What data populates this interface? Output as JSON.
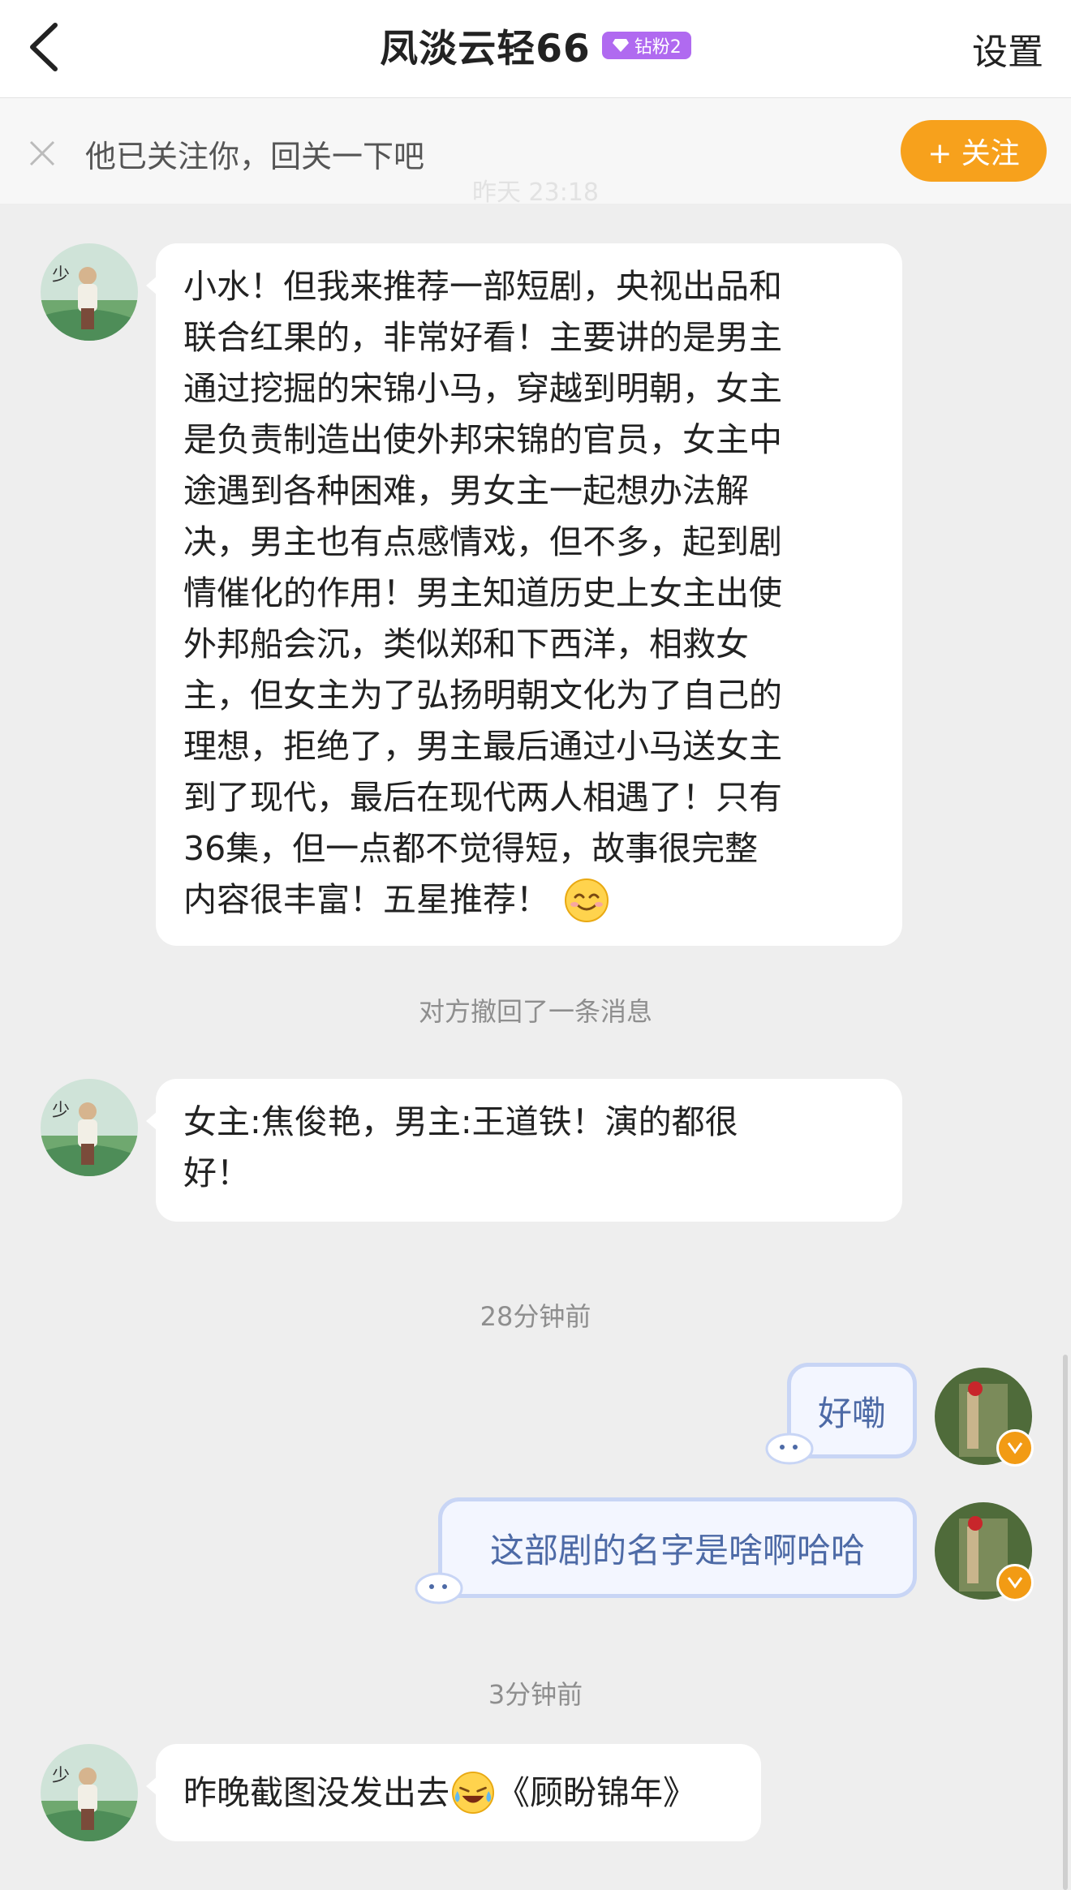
{
  "header": {
    "title": "凤淡云轻66",
    "fan_badge": "钻粉2",
    "settings_label": "设置"
  },
  "follow_bar": {
    "text": "他已关注你，回关一下吧",
    "button_label": "+ 关注",
    "ghost_timestamp": "昨天 23:18"
  },
  "messages": [
    {
      "side": "incoming",
      "text": "小水！但我来推荐一部短剧，央视出品和联合红果的，非常好看！主要讲的是男主通过挖掘的宋锦小马，穿越到明朝，女主是负责制造出使外邦宋锦的官员，女主中途遇到各种困难，男女主一起想办法解决，男主也有点感情戏，但不多，起到剧情催化的作用！男主知道历史上女主出使外邦船会沉，类似郑和下西洋，相救女主，但女主为了弘扬明朝文化为了自己的理想，拒绝了，男主最后通过小马送女主到了现代，最后在现代两人相遇了！只有36集，但一点都不觉得短，故事很完整内容很丰富！五星推荐！",
      "lines": [
        "小水！但我来推荐一部短剧，央视出品和",
        "联合红果的，非常好看！主要讲的是男主",
        "通过挖掘的宋锦小马，穿越到明朝，女主",
        "是负责制造出使外邦宋锦的官员，女主中",
        "途遇到各种困难，男女主一起想办法解",
        "决，男主也有点感情戏，但不多，起到剧",
        "情催化的作用！男主知道历史上女主出使",
        "外邦船会沉，类似郑和下西洋，相救女",
        "主，但女主为了弘扬明朝文化为了自己的",
        "理想，拒绝了，男主最后通过小马送女主",
        "到了现代，最后在现代两人相遇了！只有",
        "36集，但一点都不觉得短，故事很完整",
        "内容很丰富！五星推荐！"
      ],
      "emoji": "smile"
    },
    {
      "side": "system",
      "text": "对方撤回了一条消息"
    },
    {
      "side": "incoming",
      "lines": [
        "女主:焦俊艳，男主:王道铁！演的都很",
        "好！"
      ]
    },
    {
      "side": "timestamp",
      "text": "28分钟前"
    },
    {
      "side": "outgoing",
      "text": "好嘞"
    },
    {
      "side": "outgoing",
      "text": "这部剧的名字是啥啊哈哈"
    },
    {
      "side": "timestamp",
      "text": "3分钟前"
    },
    {
      "side": "incoming",
      "before": "昨晚截图没发出去",
      "emoji": "crying-laughing",
      "after": "《顾盼锦年》"
    }
  ],
  "colors": {
    "accent_orange": "#f7a11c",
    "badge_purple": "#b06af0",
    "outgoing_text": "#4d6aa6"
  }
}
